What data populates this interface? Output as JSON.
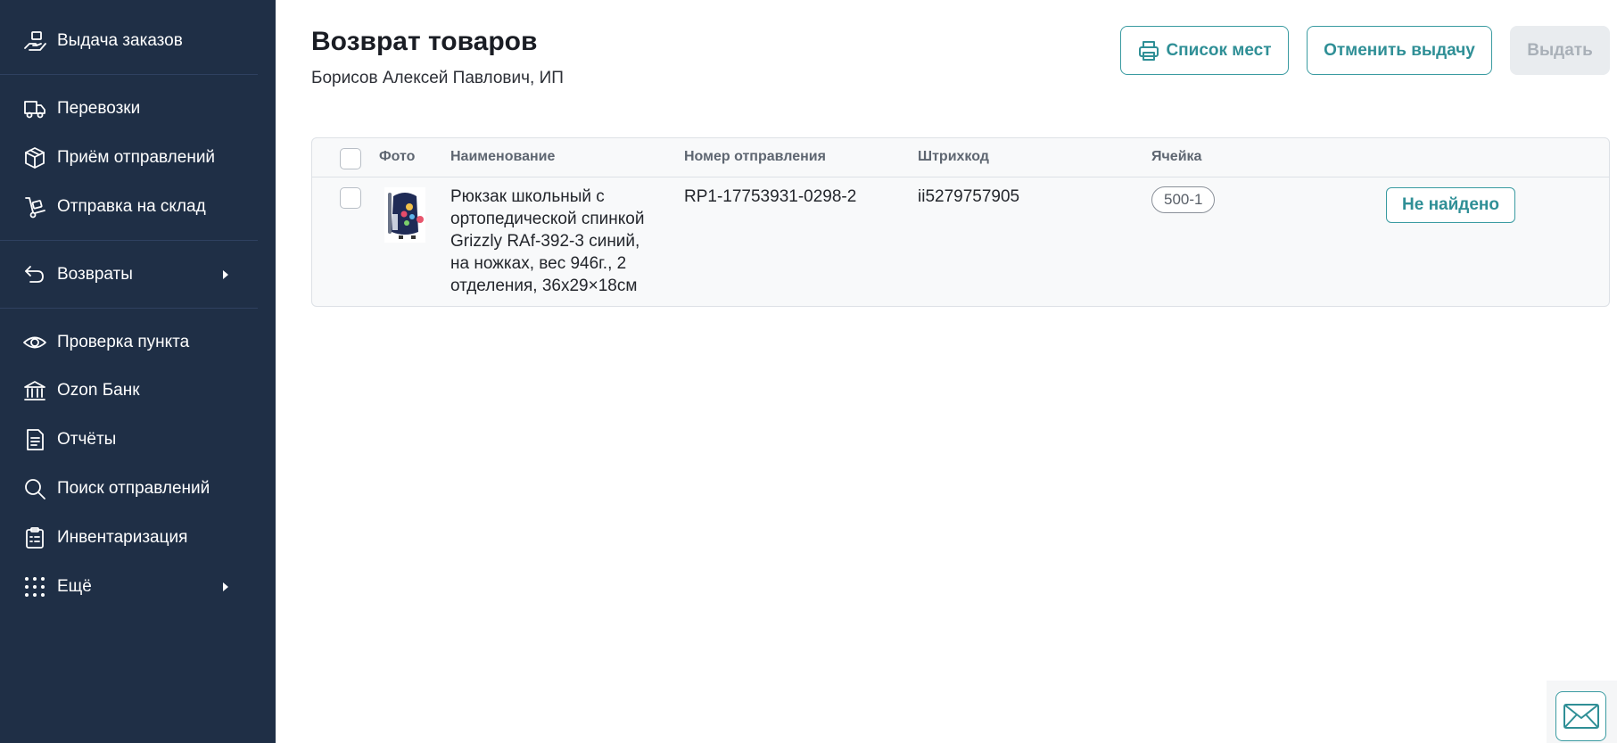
{
  "sidebar": {
    "items": [
      {
        "label": "Выдача заказов",
        "icon": "hand-package-icon"
      },
      {
        "label": "Перевозки",
        "icon": "truck-icon"
      },
      {
        "label": "Приём отправлений",
        "icon": "box-icon"
      },
      {
        "label": "Отправка на склад",
        "icon": "hand-truck-icon"
      },
      {
        "label": "Возвраты",
        "icon": "return-arrow-icon",
        "has_submenu": true
      },
      {
        "label": "Проверка пункта",
        "icon": "eye-icon"
      },
      {
        "label": "Ozon Банк",
        "icon": "bank-icon"
      },
      {
        "label": "Отчёты",
        "icon": "document-icon"
      },
      {
        "label": "Поиск отправлений",
        "icon": "search-icon"
      },
      {
        "label": "Инвентаризация",
        "icon": "clipboard-icon"
      },
      {
        "label": "Ещё",
        "icon": "grid-dots-icon",
        "has_submenu": true
      }
    ]
  },
  "header": {
    "title": "Возврат товаров",
    "subtitle": "Борисов Алексей Павлович, ИП"
  },
  "actions": {
    "places_list": "Список мест",
    "cancel_issue": "Отменить выдачу",
    "issue": "Выдать"
  },
  "table": {
    "columns": [
      "Фото",
      "Наименование",
      "Номер отправления",
      "Штрихкод",
      "Ячейка"
    ],
    "rows": [
      {
        "name_lines": [
          "Рюкзак школьный с",
          "ортопедической спинкой",
          "Grizzly RAf-392-3 синий,",
          "на ножках, вес 946г., 2",
          "отделения, 36x29×18см"
        ],
        "shipment_number": "RP1-17753931-0298-2",
        "barcode": "ii5279757905",
        "cell": "500-1",
        "status_button": "Не найдено"
      }
    ]
  },
  "colors": {
    "sidebar_bg": "#1f2f46",
    "accent": "#2f8f96",
    "disabled_bg": "#e9ecef"
  }
}
